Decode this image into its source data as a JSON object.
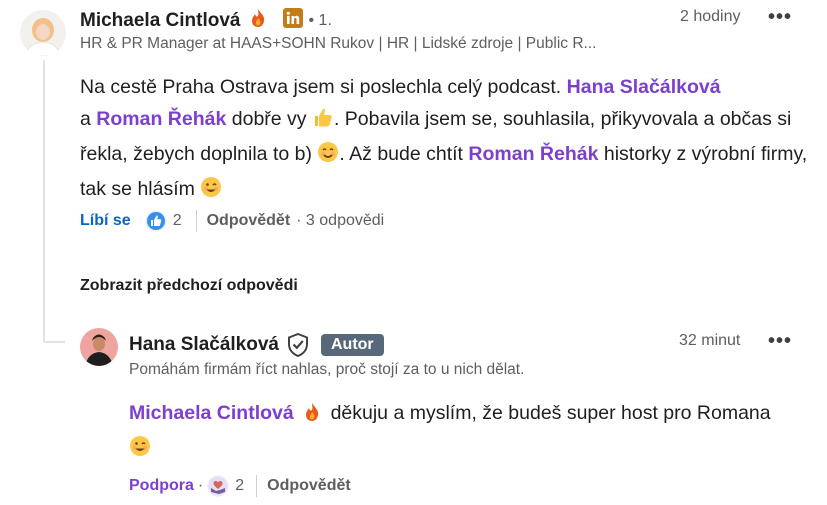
{
  "comment": {
    "author": "Michaela Cintlová",
    "degree": "• 1.",
    "headline": "HR & PR Manager at HAAS+SOHN Rukov | HR | Lidské zdroje | Public R...",
    "time": "2 hodiny",
    "more": "•••",
    "text": {
      "p1": "Na cestě Praha Ostrava jsem si poslechla celý podcast.",
      "mention1": "Hana Slačálková",
      "p2": "a",
      "mention2": "Roman Řehák",
      "p3": "dobře vy",
      "p4": ". Pobavila jsem se, souhlasila, přikyvovala a občas si řekla, žebych doplnila to b)",
      "p5": ". Až bude chtít",
      "mention3": "Roman Řehák",
      "p6": "historky z výrobní firmy, tak se hlásím"
    },
    "like_label": "Líbí se",
    "reaction_count": "2",
    "reply_label": "Odpovědět",
    "replies_count": "· 3 odpovědi"
  },
  "show_previous": "Zobrazit předchozí odpovědi",
  "reply": {
    "author": "Hana Slačálková",
    "badge": "Autor",
    "headline": "Pomáhám firmám říct nahlas, proč stojí za to u nich dělat.",
    "time": "32 minut",
    "more": "•••",
    "mention": "Michaela Cintlová",
    "text": "děkuju a myslím, že budeš super host pro Romana",
    "support_label": "Podpora",
    "dot": "·",
    "reaction_count": "2",
    "reply_label": "Odpovědět"
  },
  "colors": {
    "mention": "#7e3fce",
    "like_blue": "#0a66c2",
    "linkedin_badge": "#c37d16",
    "author_badge": "#56687a"
  },
  "icons": [
    "fire-icon",
    "linkedin-icon",
    "thumbs-up-emoji",
    "smile-emoji",
    "wink-emoji",
    "like-reaction-icon",
    "verified-shield-icon",
    "support-reaction-icon"
  ]
}
